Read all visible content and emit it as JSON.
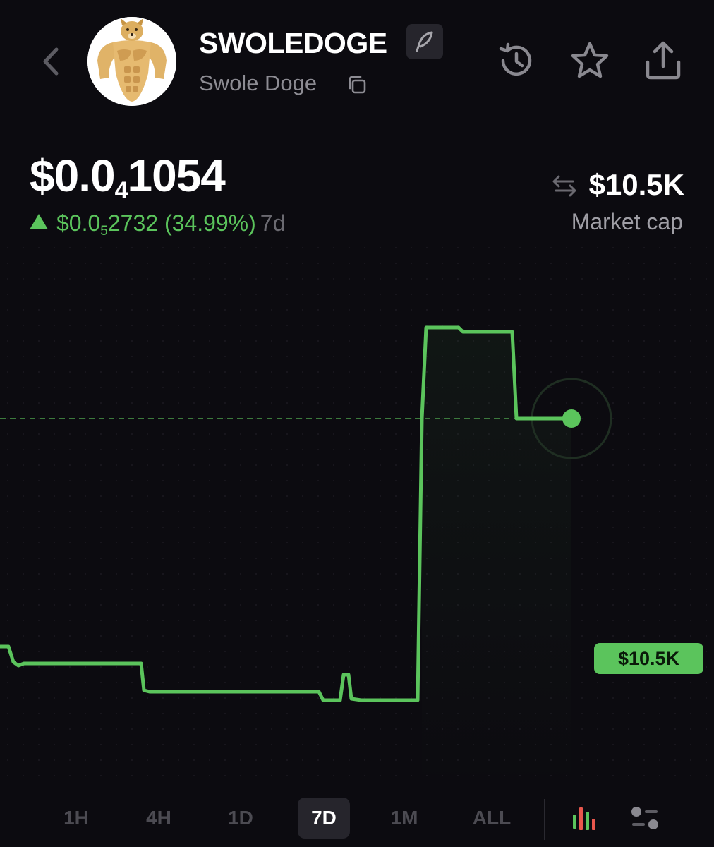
{
  "header": {
    "ticker": "SWOLEDOGE",
    "name": "Swole Doge"
  },
  "price": {
    "lead": "$0.0",
    "zeros": "4",
    "tail": "1054",
    "change_lead": "$0.0",
    "change_zeros": "5",
    "change_tail": "2732 (34.99%)",
    "period": "7d",
    "direction": "up"
  },
  "market_cap": {
    "value": "$10.5K",
    "label": "Market cap",
    "current_badge": "$10.5K"
  },
  "timeframes": [
    "1H",
    "4H",
    "1D",
    "7D",
    "1M",
    "ALL"
  ],
  "active_timeframe": "7D",
  "icons": {
    "back": "chevron-left-icon",
    "edit": "feather-icon",
    "copy": "copy-icon",
    "history": "history-icon",
    "favorite": "star-icon",
    "share": "share-icon",
    "swap": "swap-arrows-icon",
    "candles": "candlestick-icon",
    "settings": "chart-settings-icon"
  },
  "colors": {
    "background": "#0c0b10",
    "accent_green": "#5bc45c",
    "muted_text": "#8d8c93",
    "tab_inactive": "#4c4b52"
  }
}
